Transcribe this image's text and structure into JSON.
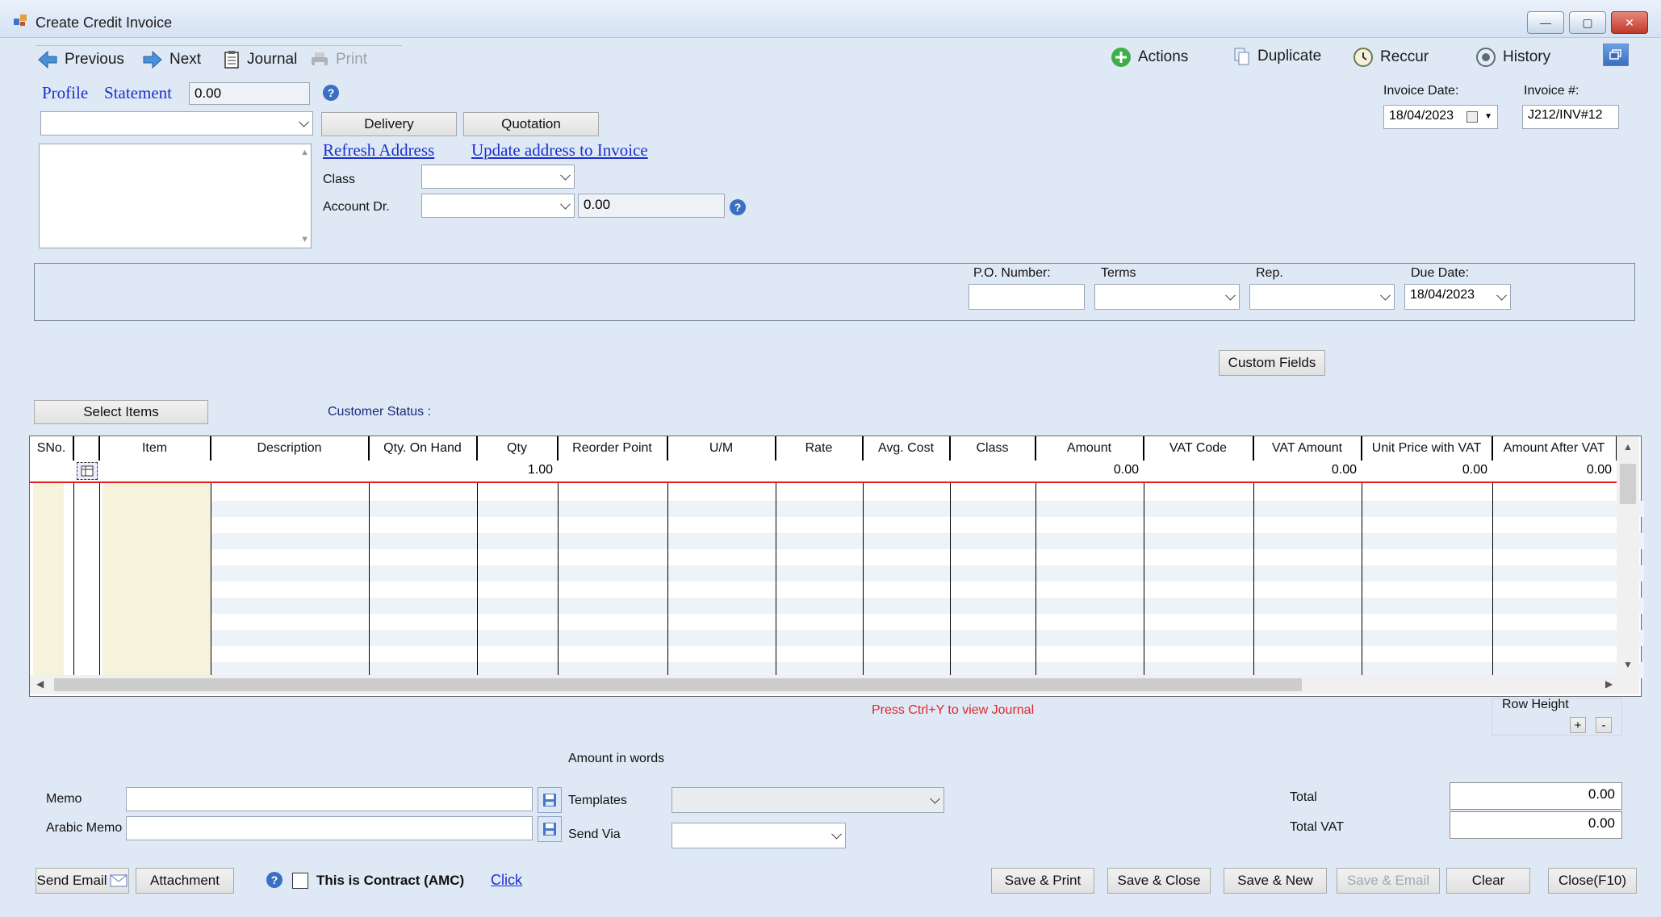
{
  "window": {
    "title": "Create Credit Invoice"
  },
  "toolbar": {
    "previous": "Previous",
    "next": "Next",
    "journal": "Journal",
    "print": "Print",
    "actions": "Actions",
    "duplicate": "Duplicate",
    "reccur": "Reccur",
    "history": "History"
  },
  "customer": {
    "profile_link": "Profile",
    "statement_link": "Statement",
    "balance": "0.00",
    "delivery_button": "Delivery",
    "quotation_button": "Quotation",
    "refresh_address": "Refresh Address",
    "update_address": "Update address to Invoice",
    "class_label": "Class",
    "account_label": "Account Dr.",
    "account_balance": "0.00"
  },
  "invoice": {
    "date_label": "Invoice Date:",
    "date_value": "18/04/2023",
    "number_label": "Invoice #:",
    "number_value": "J212/INV#12"
  },
  "details": {
    "po_label": "P.O. Number:",
    "terms_label": "Terms",
    "rep_label": "Rep.",
    "due_label": "Due Date:",
    "due_value": "18/04/2023",
    "custom_fields": "Custom Fields"
  },
  "items": {
    "select_items": "Select Items",
    "customer_status": "Customer Status :"
  },
  "grid": {
    "columns": [
      "SNo.",
      "",
      "Item",
      "Description",
      "Qty. On Hand",
      "Qty",
      "Reorder Point",
      "U/M",
      "Rate",
      "Avg. Cost",
      "Class",
      "Amount",
      "VAT Code",
      "VAT Amount",
      "Unit Price with VAT",
      "Amount After VAT"
    ],
    "row1": {
      "qty": "1.00",
      "amount": "0.00",
      "vat_amount": "0.00",
      "unit_price_vat": "0.00",
      "amount_after_vat": "0.00"
    }
  },
  "footer": {
    "journal_hint": "Press Ctrl+Y to view Journal",
    "row_height": "Row Height",
    "row_plus": "+",
    "row_minus": "-",
    "amount_in_words": "Amount in words",
    "memo_label": "Memo",
    "arabic_memo_label": "Arabic Memo",
    "templates_label": "Templates",
    "send_via_label": "Send Via",
    "total_label": "Total",
    "total_value": "0.00",
    "total_vat_label": "Total VAT",
    "total_vat_value": "0.00",
    "send_email": "Send Email",
    "attachment": "Attachment",
    "contract_label": "This is Contract (AMC)",
    "click_link": "Click",
    "save_print": "Save & Print",
    "save_close": "Save & Close",
    "save_new": "Save & New",
    "save_email": "Save & Email",
    "clear": "Clear",
    "close": "Close(F10)"
  }
}
